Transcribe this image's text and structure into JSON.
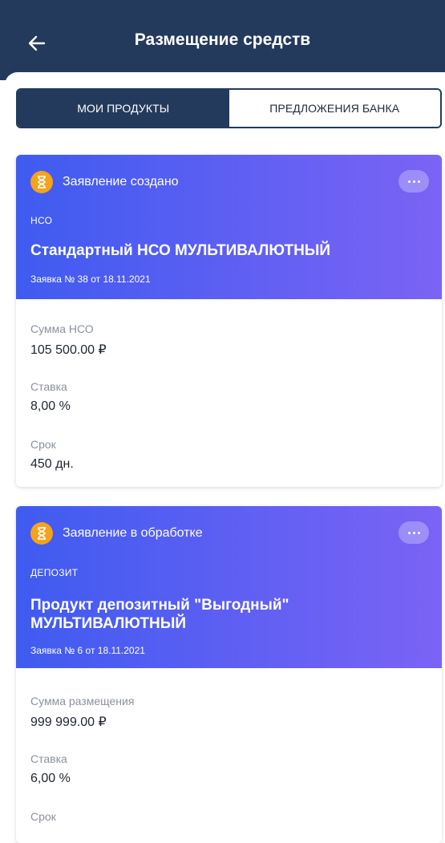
{
  "header": {
    "title": "Размещение средств"
  },
  "tabs": [
    {
      "label": "МОИ ПРОДУКТЫ",
      "active": true
    },
    {
      "label": "ПРЕДЛОЖЕНИЯ БАНКА",
      "active": false
    }
  ],
  "cards": [
    {
      "status": "Заявление создано",
      "type": "НСО",
      "name": "Стандартный НСО МУЛЬТИВАЛЮТНЫЙ",
      "request": "Заявка № 38 от 18.11.2021",
      "fields": [
        {
          "label": "Сумма НСО",
          "value": "105 500.00 ₽"
        },
        {
          "label": "Ставка",
          "value": "8,00 %"
        },
        {
          "label": "Срок",
          "value": "450 дн."
        }
      ]
    },
    {
      "status": "Заявление в обработке",
      "type": "ДЕПОЗИТ",
      "name_line1": "Продукт депозитный \"Выгодный\"",
      "name_line2": "МУЛЬТИВАЛЮТНЫЙ",
      "request": "Заявка № 6 от 18.11.2021",
      "fields": [
        {
          "label": "Сумма размещения",
          "value": "999 999.00 ₽"
        },
        {
          "label": "Ставка",
          "value": "6,00 %"
        },
        {
          "label": "Срок",
          "value": ""
        }
      ]
    }
  ],
  "colors": {
    "header": "#243a5c",
    "status_icon": "#f5a31b",
    "card_gradient_start": "#3f5bf0",
    "card_gradient_end": "#7b63f5"
  },
  "icons": {
    "back": "arrow-left-icon",
    "status": "hourglass-icon",
    "more": "more-horizontal-icon"
  }
}
